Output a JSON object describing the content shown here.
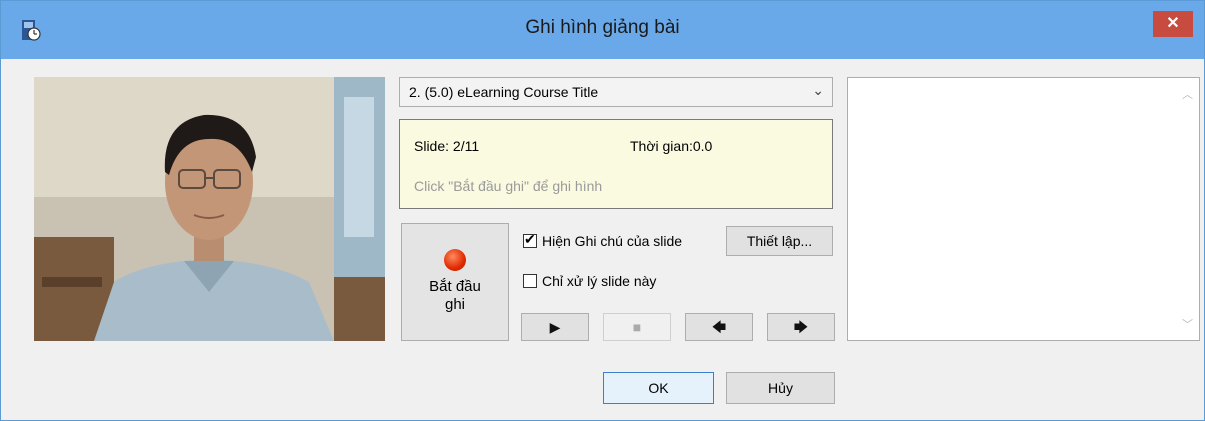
{
  "window": {
    "title": "Ghi hình giảng bài",
    "close_symbol": "✕"
  },
  "course_select": {
    "value": "2. (5.0) eLearning Course Title"
  },
  "info": {
    "slide": "Slide: 2/11",
    "time": "Thời gian:0.0",
    "hint": "Click \"Bắt đầu ghi\" để ghi hình"
  },
  "record_button": {
    "label_line1": "Bắt đầu",
    "label_line2": "ghi"
  },
  "options": {
    "show_notes_label": "Hiện Ghi chú của slide",
    "show_notes_checked": true,
    "only_this_slide_label": "Chỉ xử lý slide này",
    "only_this_slide_checked": false
  },
  "settings_button": {
    "label": "Thiết lập..."
  },
  "controls": {
    "play": "▶",
    "stop": "■",
    "prev": "🡄",
    "next": "🡆"
  },
  "footer": {
    "ok_label": "OK",
    "cancel_label": "Hủy"
  },
  "colors": {
    "titlebar": "#6aa9e9",
    "close": "#c74b3e",
    "info_bg": "#fafae0",
    "record": "#e02a00"
  }
}
